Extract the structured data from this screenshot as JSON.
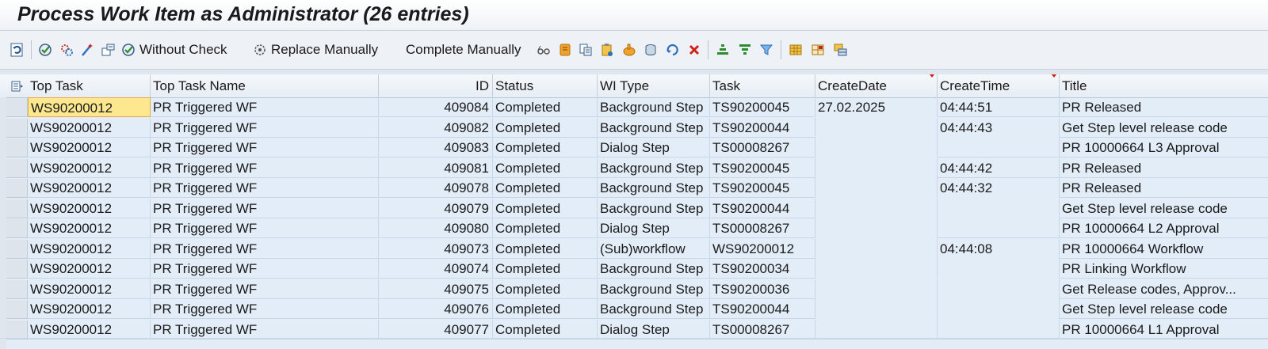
{
  "window": {
    "title": "Process Work Item as Administrator (26 entries)"
  },
  "toolbar": {
    "icons": [
      {
        "name": "refresh-icon"
      },
      {
        "name": "execute-icon"
      },
      {
        "name": "settings-gears-icon"
      },
      {
        "name": "wizard-icon"
      },
      {
        "name": "forward-icon"
      }
    ],
    "without_check_label": "Without Check",
    "replace_manually_label": "Replace Manually",
    "complete_manually_label": "Complete Manually",
    "icons_right": [
      {
        "name": "glasses-icon"
      },
      {
        "name": "scroll-icon"
      },
      {
        "name": "log-icon"
      },
      {
        "name": "clipboard-icon"
      },
      {
        "name": "hand-icon"
      },
      {
        "name": "database-icon"
      },
      {
        "name": "restart-icon"
      },
      {
        "name": "delete-icon"
      },
      {
        "name": "sort-ascending-icon"
      },
      {
        "name": "sort-descending-icon"
      },
      {
        "name": "filter-icon"
      },
      {
        "name": "layout-icon"
      },
      {
        "name": "change-layout-icon"
      },
      {
        "name": "export-icon"
      }
    ]
  },
  "table": {
    "columns": [
      "Top Task",
      "Top Task Name",
      "ID",
      "Status",
      "WI Type",
      "Task",
      "CreateDate",
      "CreateTime",
      "Title"
    ],
    "rows": [
      {
        "top_task": "WS90200012",
        "top_task_name": "PR Triggered WF",
        "id": "409084",
        "status": "Completed",
        "wi_type": "Background Step",
        "task": "TS90200045",
        "create_date": "27.02.2025",
        "create_time": "04:44:51",
        "title": "PR Released"
      },
      {
        "top_task": "WS90200012",
        "top_task_name": "PR Triggered WF",
        "id": "409082",
        "status": "Completed",
        "wi_type": "Background Step",
        "task": "TS90200044",
        "create_date": "",
        "create_time": "04:44:43",
        "title": "Get Step level release code"
      },
      {
        "top_task": "WS90200012",
        "top_task_name": "PR Triggered WF",
        "id": "409083",
        "status": "Completed",
        "wi_type": "Dialog Step",
        "task": "TS00008267",
        "create_date": "",
        "create_time": "",
        "title": "PR 10000664 L3 Approval"
      },
      {
        "top_task": "WS90200012",
        "top_task_name": "PR Triggered WF",
        "id": "409081",
        "status": "Completed",
        "wi_type": "Background Step",
        "task": "TS90200045",
        "create_date": "",
        "create_time": "04:44:42",
        "title": "PR Released"
      },
      {
        "top_task": "WS90200012",
        "top_task_name": "PR Triggered WF",
        "id": "409078",
        "status": "Completed",
        "wi_type": "Background Step",
        "task": "TS90200045",
        "create_date": "",
        "create_time": "04:44:32",
        "title": "PR Released"
      },
      {
        "top_task": "WS90200012",
        "top_task_name": "PR Triggered WF",
        "id": "409079",
        "status": "Completed",
        "wi_type": "Background Step",
        "task": "TS90200044",
        "create_date": "",
        "create_time": "",
        "title": "Get Step level release code"
      },
      {
        "top_task": "WS90200012",
        "top_task_name": "PR Triggered WF",
        "id": "409080",
        "status": "Completed",
        "wi_type": "Dialog Step",
        "task": "TS00008267",
        "create_date": "",
        "create_time": "",
        "title": "PR 10000664 L2 Approval"
      },
      {
        "top_task": "WS90200012",
        "top_task_name": "PR Triggered WF",
        "id": "409073",
        "status": "Completed",
        "wi_type": "(Sub)workflow",
        "task": "WS90200012",
        "create_date": "",
        "create_time": "04:44:08",
        "title": "PR 10000664 Workflow"
      },
      {
        "top_task": "WS90200012",
        "top_task_name": "PR Triggered WF",
        "id": "409074",
        "status": "Completed",
        "wi_type": "Background Step",
        "task": "TS90200034",
        "create_date": "",
        "create_time": "",
        "title": "PR Linking Workflow"
      },
      {
        "top_task": "WS90200012",
        "top_task_name": "PR Triggered WF",
        "id": "409075",
        "status": "Completed",
        "wi_type": "Background Step",
        "task": "TS90200036",
        "create_date": "",
        "create_time": "",
        "title": "Get Release codes, Approv..."
      },
      {
        "top_task": "WS90200012",
        "top_task_name": "PR Triggered WF",
        "id": "409076",
        "status": "Completed",
        "wi_type": "Background Step",
        "task": "TS90200044",
        "create_date": "",
        "create_time": "",
        "title": "Get Step level release code"
      },
      {
        "top_task": "WS90200012",
        "top_task_name": "PR Triggered WF",
        "id": "409077",
        "status": "Completed",
        "wi_type": "Dialog Step",
        "task": "TS00008267",
        "create_date": "",
        "create_time": "",
        "title": "PR 10000664 L1 Approval"
      }
    ]
  }
}
